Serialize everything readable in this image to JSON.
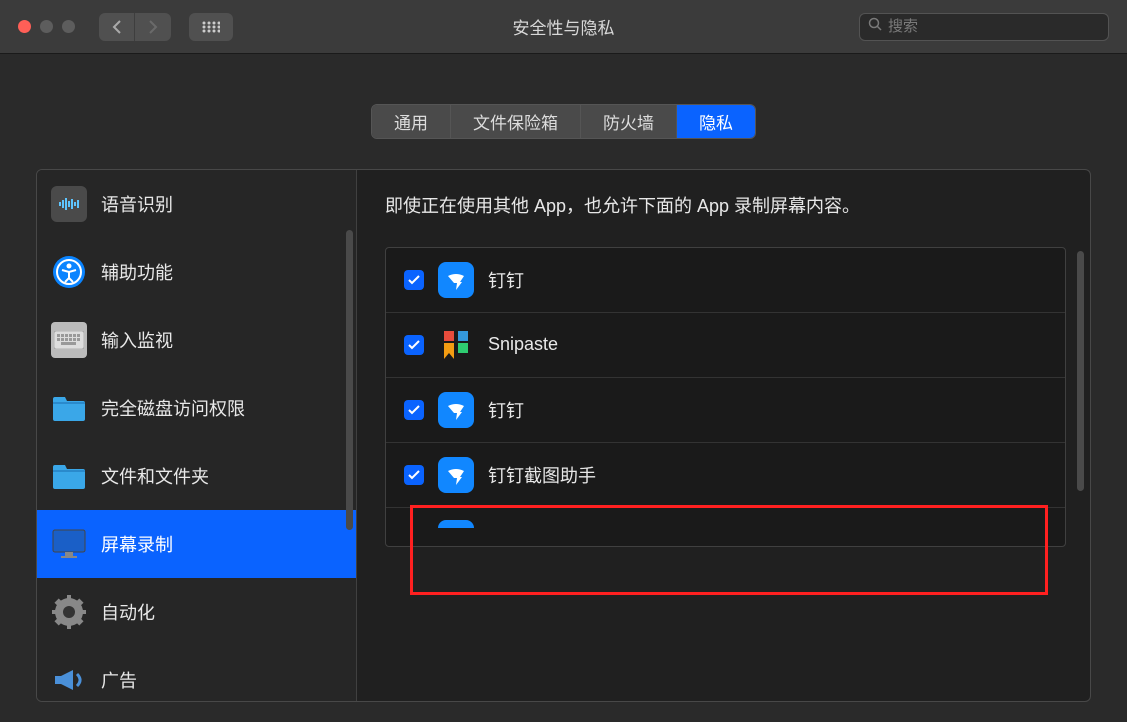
{
  "window": {
    "title": "安全性与隐私"
  },
  "search": {
    "placeholder": "搜索"
  },
  "tabs": [
    {
      "label": "通用",
      "active": false
    },
    {
      "label": "文件保险箱",
      "active": false
    },
    {
      "label": "防火墙",
      "active": false
    },
    {
      "label": "隐私",
      "active": true
    }
  ],
  "sidebar": {
    "items": [
      {
        "label": "语音识别",
        "icon": "voice",
        "selected": false
      },
      {
        "label": "辅助功能",
        "icon": "accessibility",
        "selected": false
      },
      {
        "label": "输入监视",
        "icon": "keyboard",
        "selected": false
      },
      {
        "label": "完全磁盘访问权限",
        "icon": "folder",
        "selected": false
      },
      {
        "label": "文件和文件夹",
        "icon": "folder",
        "selected": false
      },
      {
        "label": "屏幕录制",
        "icon": "display",
        "selected": true
      },
      {
        "label": "自动化",
        "icon": "gear",
        "selected": false
      },
      {
        "label": "广告",
        "icon": "megaphone",
        "selected": false
      }
    ]
  },
  "main": {
    "description": "即使正在使用其他 App，也允许下面的 App 录制屏幕内容。",
    "apps": [
      {
        "name": "钉钉",
        "checked": true,
        "icon": "dingtalk"
      },
      {
        "name": "Snipaste",
        "checked": true,
        "icon": "snipaste"
      },
      {
        "name": "钉钉",
        "checked": true,
        "icon": "dingtalk"
      },
      {
        "name": "钉钉截图助手",
        "checked": true,
        "icon": "dingtalk"
      }
    ]
  }
}
